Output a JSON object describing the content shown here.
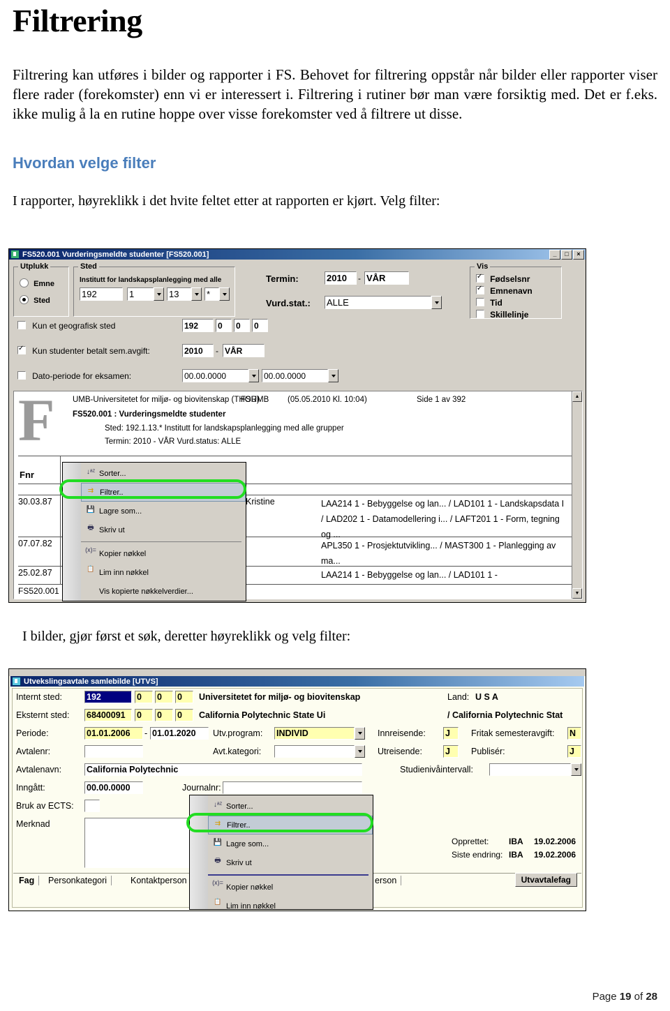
{
  "doc": {
    "title": "Filtrering",
    "intro": "Filtrering kan utføres i bilder og rapporter i FS. Behovet for filtrering oppstår når bilder eller rapporter viser flere rader (forekomster) enn vi er interessert i. Filtrering i rutiner bør man være forsiktig med. Det er f.eks. ikke mulig å la en rutine hoppe over visse forekomster ved å filtrere ut disse.",
    "section_heading": "Hvordan velge filter",
    "lead_reports": "I rapporter, høyreklikk i det hvite feltet etter at rapporten er kjørt. Velg filter:",
    "lead_images": "I bilder, gjør først et søk, deretter høyreklikk og velg filter:",
    "footer_prefix": "Page ",
    "footer_page": "19",
    "footer_mid": " of ",
    "footer_total": "28",
    "accent_color": "#4a7ebb",
    "highlight_color": "#22dd22"
  },
  "report_window": {
    "title": "FS520.001 Vurderingsmeldte studenter [FS520.001]",
    "titlebar_buttons": [
      "_",
      "□",
      "×"
    ],
    "utplukk": {
      "legend": "Utplukk",
      "options": [
        {
          "label": "Emne",
          "selected": false
        },
        {
          "label": "Sted",
          "selected": true
        }
      ]
    },
    "sted": {
      "legend": "Sted",
      "description": "Institutt for landskapsplanlegging med alle",
      "values": [
        "192",
        "1",
        "13",
        "*"
      ]
    },
    "termin": {
      "label": "Termin:",
      "year": "2010",
      "sep": "-",
      "season": "VÅR"
    },
    "vurdstat": {
      "label": "Vurd.stat.:",
      "value": "ALLE"
    },
    "vis": {
      "legend": "Vis",
      "items": [
        {
          "label": "Fødselsnr",
          "checked": true
        },
        {
          "label": "Emnenavn",
          "checked": true
        },
        {
          "label": "Tid",
          "checked": false
        },
        {
          "label": "Skillelinje",
          "checked": false
        }
      ]
    },
    "checkrows": [
      {
        "label": "Kun et geografisk sted",
        "checked": false,
        "fields": [
          "192",
          "0",
          "0",
          "0"
        ]
      },
      {
        "label": "Kun studenter betalt sem.avgift:",
        "checked": true,
        "fields": [
          "2010",
          "VÅR"
        ],
        "sep": "-"
      },
      {
        "label": "Dato-periode for eksamen:",
        "checked": false,
        "fields": [
          "00.00.0000",
          "00.00.0000"
        ]
      }
    ],
    "report_header": {
      "line1_left": "UMB-Universitetet for miljø- og biovitenskap (THOR)",
      "line1_mid": "FSUMB",
      "line1_date": "(05.05.2010 Kl. 10:04)",
      "line1_right": "Side 1 av 392",
      "line2": "FS520.001 : Vurderingsmeldte studenter",
      "line3": "Sted: 192.1.13.* Institutt for landskapsplanlegging med alle grupper",
      "line4": "Termin:  2010 - VÅR Vurd.status: ALLE"
    },
    "table": {
      "col_header": "Fnr",
      "rows": [
        {
          "fnr": "30.03.87",
          "name": "Kristine",
          "courses": "LAA214 1 - Bebyggelse og lan... / LAD101 1 - Landskapsdata I / LAD202 1 - Datamodellering i... / LAFT201 1 - Form, tegning og ..."
        },
        {
          "fnr": "07.07.82",
          "name": "",
          "courses": "APL350 1 - Prosjektutvikling... / MAST300 1 - Planlegging av ma..."
        },
        {
          "fnr": "25.02.87",
          "name": "",
          "courses": "LAA214 1 - Bebyggelse og lan... / LAD101 1 -"
        }
      ],
      "footer_label": "FS520.001"
    },
    "context_menu": {
      "items": [
        {
          "label": "Sorter...",
          "icon": "sort-az-icon",
          "selected": false,
          "sep_after": false
        },
        {
          "label": "Filtrer..",
          "icon": "filter-icon",
          "selected": true,
          "sep_after": false
        },
        {
          "label": "Lagre som...",
          "icon": "save-icon",
          "selected": false,
          "sep_after": false
        },
        {
          "label": "Skriv ut",
          "icon": "print-icon",
          "selected": false,
          "sep_after": true
        },
        {
          "label": "Kopier nøkkel",
          "icon": "copy-key-icon",
          "selected": false,
          "sep_after": false
        },
        {
          "label": "Lim inn nøkkel",
          "icon": "paste-key-icon",
          "selected": false,
          "sep_after": false
        },
        {
          "label": "Vis kopierte nøkkelverdier...",
          "icon": "show-keys-icon",
          "selected": false,
          "sep_after": false
        }
      ]
    }
  },
  "image_window": {
    "title": "Utvekslingsavtale samlebilde  [UTVS]",
    "fields": {
      "internt_sted": {
        "label": "Internt sted:",
        "values": [
          "192",
          "0",
          "0",
          "0"
        ],
        "desc": "Universitetet for miljø- og biovitenskap"
      },
      "eksternt_sted": {
        "label": "Eksternt sted:",
        "values": [
          "68400091",
          "0",
          "0",
          "0"
        ],
        "desc": "California Polytechnic State Ui"
      },
      "periode": {
        "label": "Periode:",
        "from": "01.01.2006",
        "sep": "-",
        "to": "01.01.2020"
      },
      "avtalenr": {
        "label": "Avtalenr:",
        "value": ""
      },
      "avtalenavn": {
        "label": "Avtalenavn:",
        "value": "California Polytechnic"
      },
      "inngatt": {
        "label": "Inngått:",
        "value": "00.00.0000"
      },
      "journalnr": {
        "label": "Journalnr:",
        "value": ""
      },
      "bruk_ects": {
        "label": "Bruk av ECTS:",
        "value": ""
      },
      "merknad": {
        "label": "Merknad",
        "value": ""
      },
      "utv_program": {
        "label": "Utv.program:",
        "value": "INDIVID"
      },
      "avt_kategori": {
        "label": "Avt.kategori:",
        "value": ""
      },
      "land": {
        "label": "Land:",
        "value": "U S A"
      },
      "land_desc": "/ California Polytechnic Stat",
      "innreisende": {
        "label": "Innreisende:",
        "value": "J"
      },
      "utreisende": {
        "label": "Utreisende:",
        "value": "J"
      },
      "fritak": {
        "label": "Fritak semesteravgift:",
        "value": "N"
      },
      "publiser": {
        "label": "Publisér:",
        "value": "J"
      },
      "studieniva": {
        "label": "Studienivåintervall:",
        "value": ""
      }
    },
    "meta": [
      {
        "label": "Opprettet:",
        "user": "IBA",
        "date": "19.02.2006"
      },
      {
        "label": "Siste endring:",
        "user": "IBA",
        "date": "19.02.2006"
      }
    ],
    "tabs": [
      "Fag",
      "Personkategori",
      "Kontaktperson",
      "erson"
    ],
    "tab_button": "Utvavtalefag",
    "context_menu": {
      "items": [
        {
          "label": "Sorter...",
          "icon": "sort-az-icon",
          "selected": false,
          "sep_after": false
        },
        {
          "label": "Filtrer..",
          "icon": "filter-icon",
          "selected": true,
          "sep_after": false
        },
        {
          "label": "Lagre som...",
          "icon": "save-icon",
          "selected": false,
          "sep_after": false
        },
        {
          "label": "Skriv ut",
          "icon": "print-icon",
          "selected": false,
          "sep_after": true
        },
        {
          "label": "Kopier nøkkel",
          "icon": "copy-key-icon",
          "selected": false,
          "sep_after": false
        },
        {
          "label": "Lim inn nøkkel",
          "icon": "paste-key-icon",
          "selected": false,
          "sep_after": false
        }
      ]
    }
  }
}
